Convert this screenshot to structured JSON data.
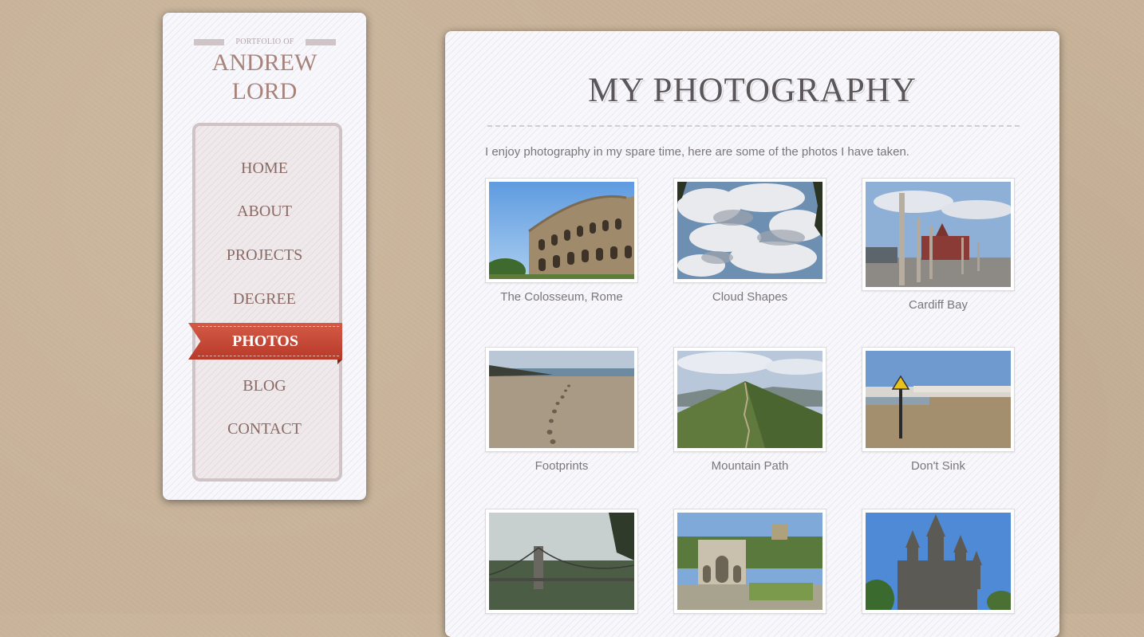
{
  "sidebar": {
    "portfolio_of": "PORTFOLIO OF",
    "name_line1": "ANDREW",
    "name_line2": "LORD",
    "nav": [
      "HOME",
      "ABOUT",
      "PROJECTS",
      "DEGREE",
      "PHOTOS",
      "BLOG",
      "CONTACT"
    ],
    "active": "PHOTOS"
  },
  "main": {
    "title": "MY PHOTOGRAPHY",
    "intro": "I enjoy photography in my spare time, here are some of the photos I have taken.",
    "photos": [
      {
        "caption": "The Colosseum, Rome",
        "icon": "colosseum-photo"
      },
      {
        "caption": "Cloud Shapes",
        "icon": "clouds-photo"
      },
      {
        "caption": "Cardiff Bay",
        "icon": "cardiff-bay-photo"
      },
      {
        "caption": "Footprints",
        "icon": "footprints-beach-photo"
      },
      {
        "caption": "Mountain Path",
        "icon": "mountain-path-photo"
      },
      {
        "caption": "Don't Sink",
        "icon": "beach-sign-photo"
      },
      {
        "caption": "",
        "icon": "suspension-bridge-photo"
      },
      {
        "caption": "",
        "icon": "triumphal-arch-photo"
      },
      {
        "caption": "",
        "icon": "castle-photo"
      }
    ]
  },
  "colors": {
    "accent": "#c0432f",
    "nav_text": "#8a6a64",
    "name_text": "#a7837a",
    "background": "#c9b49a"
  }
}
